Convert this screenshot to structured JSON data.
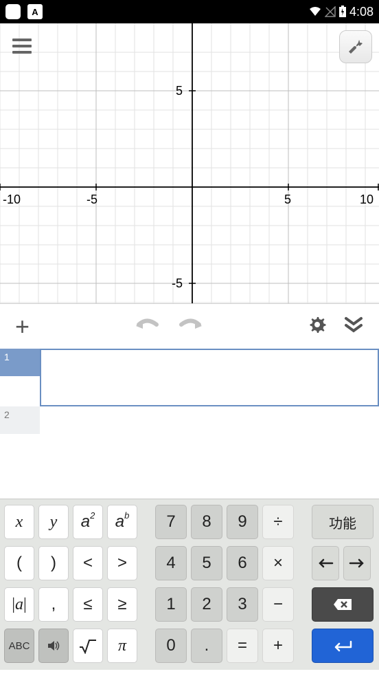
{
  "status": {
    "a_label": "A",
    "time": "4:08"
  },
  "graph": {
    "x_ticks": [
      "-10",
      "-5",
      "5",
      "10"
    ],
    "y_ticks": [
      "5",
      "-5"
    ],
    "x_range": [
      -11,
      11
    ],
    "y_range": [
      -8,
      8
    ]
  },
  "inputs": {
    "row1_num": "1",
    "row1_value": "",
    "row2_num": "2"
  },
  "keys": {
    "x": "x",
    "y": "y",
    "a2_base": "a",
    "a2_exp": "2",
    "ab_base": "a",
    "ab_exp": "b",
    "lparen": "(",
    "rparen": ")",
    "lt": "<",
    "gt": ">",
    "abs": "|a|",
    "comma": ",",
    "le": "≤",
    "ge": "≥",
    "abc": "ABC",
    "sqrt": "√",
    "pi": "π",
    "n7": "7",
    "n8": "8",
    "n9": "9",
    "div": "÷",
    "n4": "4",
    "n5": "5",
    "n6": "6",
    "mul": "×",
    "n1": "1",
    "n2": "2",
    "n3": "3",
    "sub": "−",
    "n0": "0",
    "dot": ".",
    "eq": "=",
    "add": "+",
    "func": "功能",
    "left": "←",
    "right": "→"
  }
}
